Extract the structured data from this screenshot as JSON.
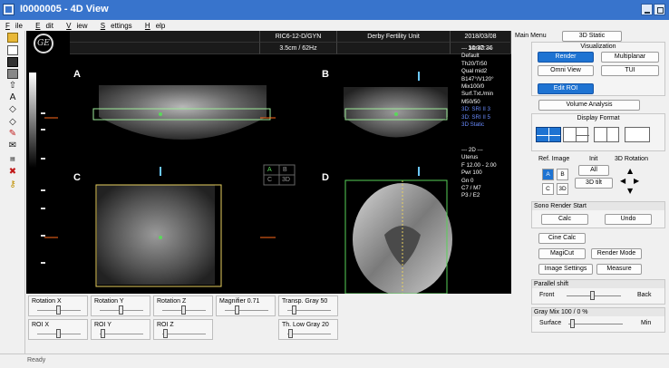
{
  "window": {
    "title": "I0000005 - 4D View"
  },
  "menu": [
    {
      "label": "File",
      "u": "F",
      "rest": "ile"
    },
    {
      "label": "Edit",
      "u": "E",
      "rest": "dit"
    },
    {
      "label": "View",
      "u": "V",
      "rest": "iew"
    },
    {
      "label": "Settings",
      "u": "S",
      "rest": "ettings"
    },
    {
      "label": "Help",
      "u": "H",
      "rest": "elp"
    }
  ],
  "viewer": {
    "header": {
      "probe": "RIC6-12-D/GYN",
      "institution": "Derby Fertility Unit",
      "date": "2018/03/08",
      "freq": "3.5cm / 62Hz",
      "time": "14:37:36",
      "logo": "GE"
    },
    "quadrants": {
      "a": "A",
      "b": "B",
      "c": "C",
      "d": "D"
    },
    "mini_labels": {
      "a": "A",
      "b": "B",
      "c": "C",
      "d": "3D"
    },
    "info3d": [
      "--- 3D/4D ---",
      "Default",
      "Th20/Tr50",
      "Qual mid2",
      "B147°/V120°",
      "Mix100/0",
      "Surf.Txt./min",
      "M50/50"
    ],
    "info3d_blue": [
      "3D: SRI II 3",
      "3D: SRI II 5",
      "3D Static"
    ],
    "info2d": [
      "--- 2D ---",
      "Uterus",
      "F 12.00 - 2.00",
      "Pwr 100",
      "Gn 0",
      "C7 / M7",
      "P3 / E2"
    ]
  },
  "controls": {
    "rotation_x": "Rotation X",
    "rotation_y": "Rotation Y",
    "rotation_z": "Rotation Z",
    "magnifier": "Magnifier 0.71",
    "transp": "Transp. Gray 50",
    "roi_x": "ROI X",
    "roi_y": "ROI Y",
    "roi_z": "ROI Z",
    "th_low": "Th. Low Gray 20"
  },
  "status": "Ready",
  "panel": {
    "main_menu": "Main Menu",
    "mode": "3D Static",
    "visualization": "Visualization",
    "render": "Render",
    "multiplanar": "Multiplanar",
    "omni_view": "Omni View",
    "tui": "TUI",
    "edit_roi": "Edit ROI",
    "volume_analysis": "Volume Analysis",
    "display_format": "Display Format",
    "ref_image": "Ref. Image",
    "init": "Init",
    "rotation_3d": "3D Rotation",
    "ref_a": "A",
    "ref_b": "B",
    "ref_c": "C",
    "ref_3d": "3D",
    "all": "All",
    "tilt": "3D tilt",
    "sono_render_start": "Sono Render Start",
    "calc": "Calc",
    "undo": "Undo",
    "cine_calc": "Cine Calc",
    "magicut": "MagiCut",
    "render_mode": "Render Mode",
    "image_settings": "Image Settings",
    "measure": "Measure",
    "parallel_shift": "Parallel shift",
    "front": "Front",
    "back": "Back",
    "gray_mix": "Gray Mix 100 / 0 %",
    "surface": "Surface",
    "min": "Min"
  }
}
